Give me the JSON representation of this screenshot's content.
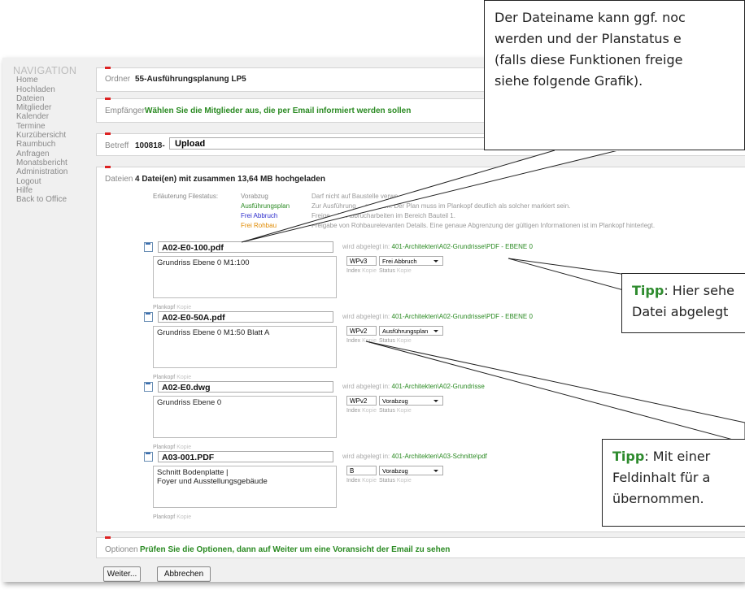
{
  "nav": {
    "title": "NAVIGATION",
    "items": [
      "Home",
      "Hochladen",
      "Dateien",
      "Mitglieder",
      "Kalender",
      "Termine",
      "Kurzübersicht",
      "Raumbuch",
      "Anfragen",
      "Monatsbericht",
      "Administration",
      "Logout",
      "Hilfe",
      "Back to Office"
    ]
  },
  "ordner": {
    "label": "Ordner",
    "value": "55-Ausführungsplanung LP5"
  },
  "empfaenger": {
    "label": "Empfänger",
    "value": "Wählen Sie die Mitglieder aus, die per Email informiert werden sollen"
  },
  "betreff": {
    "label": "Betreff",
    "prefix": "100818-",
    "value": "Upload"
  },
  "dateien": {
    "label": "Dateien",
    "summary": "4 Datei(en) mit zusammen 13,64 MB hochgeladen",
    "legend_title": "Erläuterung Filestatus:",
    "legend": [
      {
        "name": "Vorabzug",
        "desc": "Darf nicht auf Baustelle verwe"
      },
      {
        "name": "Ausführungsplan",
        "desc": "Zur Ausführung ... gegeben. Der Plan muss im Plankopf deutlich als solcher markiert sein."
      },
      {
        "name": "Frei Abbruch",
        "desc": "Freige... für Abbrucharbeiten im Bereich Bauteil 1."
      },
      {
        "name": "Frei Rohbau",
        "desc": "Freigabe von Rohbaurelevanten Details. Eine genaue Abgrenzung der gültigen Informationen ist im Plankopf hinterlegt."
      }
    ],
    "legend_colors": [
      "#888888",
      "#2a8a22",
      "#2a2acc",
      "#e08a00"
    ],
    "ablage_label": "wird abgelegt in:",
    "index_label": "Index",
    "status_label": "Status",
    "kopie_label": "Kopie",
    "plankopf_label": "Plankopf",
    "files": [
      {
        "name": "A02-E0-100.pdf",
        "path": "401-Architekten\\A02-Grundrisse\\PDF - EBENE 0",
        "desc": "Grundriss Ebene 0 M1:100",
        "index": "WPv3",
        "status": "Frei Abbruch"
      },
      {
        "name": "A02-E0-50A.pdf",
        "path": "401-Architekten\\A02-Grundrisse\\PDF - EBENE 0",
        "desc": "Grundriss Ebene 0 M1:50 Blatt A",
        "index": "WPv2",
        "status": "Ausführungsplan"
      },
      {
        "name": "A02-E0.dwg",
        "path": "401-Architekten\\A02-Grundrisse",
        "desc": "Grundriss Ebene 0",
        "index": "WPv2",
        "status": "Vorabzug"
      },
      {
        "name": "A03-001.PDF",
        "path": "401-Architekten\\A03-Schnitte\\pdf",
        "desc": "Schnitt Bodenplatte |\nFoyer und Ausstellungsgebäude",
        "index": "B",
        "status": "Vorabzug"
      }
    ]
  },
  "optionen": {
    "label": "Optionen",
    "value": "Prüfen Sie die Optionen, dann auf Weiter um eine Voransicht der Email zu sehen"
  },
  "buttons": {
    "weiter": "Weiter...",
    "abbrechen": "Abbrechen"
  },
  "callouts": {
    "top": [
      "Der Dateiname kann ggf. noc",
      "werden und der Planstatus e",
      "(falls diese Funktionen freige",
      "siehe folgende Grafik)."
    ],
    "middle": {
      "tipp": "Tipp",
      "line1": ": Hier sehe",
      "line2": "Datei abgelegt"
    },
    "bottom": {
      "tipp": "Tipp",
      "line1": ": Mit einer",
      "line2": "Feldinhalt für a",
      "line3": "übernommen."
    }
  }
}
